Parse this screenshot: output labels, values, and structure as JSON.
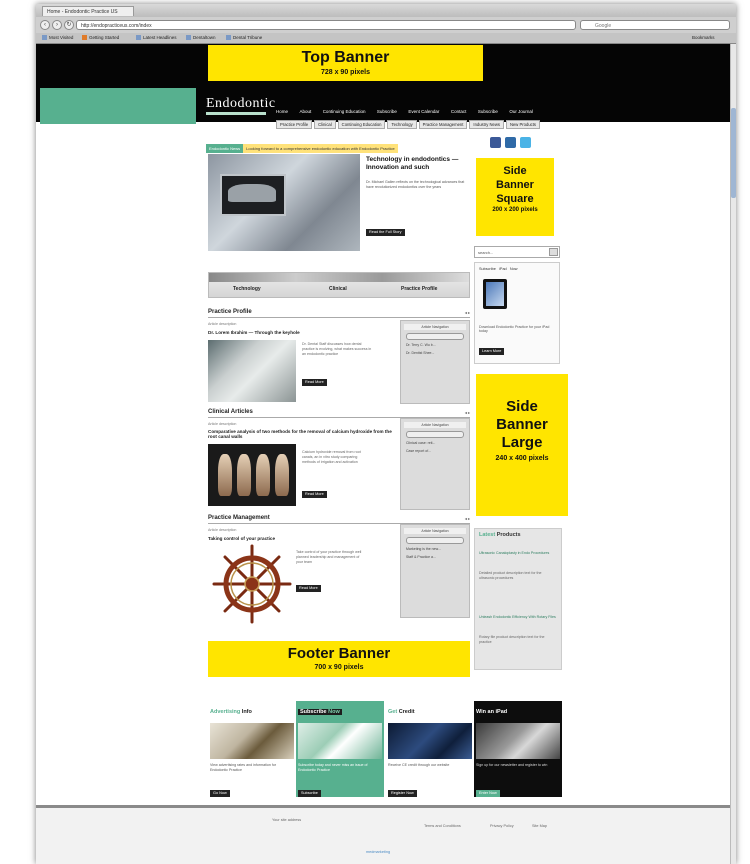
{
  "browser": {
    "tab_title": "Home - Endodontic Practice US",
    "url": "http://endopracticeus.com/index",
    "search_placeholder": "Google",
    "bookmarks": [
      "Most Visited",
      "Getting Started",
      "Latest Headlines",
      "Dentaltown",
      "Dental Tribune"
    ],
    "right_bookmark": "Bookmarks"
  },
  "banners": {
    "top": {
      "title": "Top Banner",
      "size": "728 x 90 pixels"
    },
    "side_square": {
      "line1": "Side",
      "line2": "Banner",
      "line3": "Square",
      "size": "200 x 200 pixels"
    },
    "side_large": {
      "line1": "Side",
      "line2": "Banner",
      "line3": "Large",
      "size": "240 x 400 pixels"
    },
    "footer": {
      "title": "Footer Banner",
      "size": "700 x 90 pixels"
    }
  },
  "site": {
    "logo": "Endodontic",
    "nav_primary": [
      "Home",
      "About",
      "Continuing Education",
      "Subscribe",
      "Event Calendar",
      "Contact",
      "Subscribe",
      "Our Journal"
    ],
    "nav_secondary": [
      "Practice Profile",
      "Clinical",
      "Continuing Education",
      "Technology",
      "Practice Management",
      "Industry News",
      "New Products"
    ],
    "ticker_label": "Endodontic News",
    "ticker_text": "Looking forward to a comprehensive endodontic education with Endodontic Practice"
  },
  "featured": {
    "title": "Technology in endodontics — Innovation and such",
    "desc": "Dr. Michael Gallen reflects on the technological advances that have revolutionized endodontics over the years",
    "button": "Read the Full Story"
  },
  "section_tabs": [
    "Technology",
    "Clinical",
    "Practice Profile"
  ],
  "practice_profile": {
    "heading": "Practice Profile",
    "sub": "Article description",
    "title": "Dr. Lorem Ibrahim — Through the keyhole",
    "desc": "Dr. Dental Staff discusses how dental practice is evolving, what makes success in an endodontic practice",
    "button": "Read More",
    "panel_head": "Article Navigation",
    "panel_items": [
      "Dr. Terry C. Wu b...",
      "Dr. Dentist Shee..."
    ]
  },
  "clinical": {
    "heading": "Clinical Articles",
    "sub": "Article description",
    "title": "Comparative analysis of two methods for the removal of calcium hydroxide from the root canal walls",
    "desc": "Calcium hydroxide removal from root canals, an in vitro study comparing methods of irrigation and activation",
    "button": "Read More",
    "panel_head": "Article Navigation",
    "panel_items": [
      "Clinical case: reti...",
      "Case report of..."
    ]
  },
  "practice_mgmt": {
    "heading": "Practice Management",
    "sub": "Article description",
    "title": "Taking control of your practice",
    "desc": "Take control of your practice through well planned leadership and management of your team",
    "button": "Read More",
    "panel_head": "Article Navigation",
    "panel_items": [
      "Marketing is the new...",
      "Staff & Practice a..."
    ]
  },
  "right_column": {
    "search_placeholder": "search...",
    "ipad_tabs": [
      "Subscribe",
      "iPad",
      "Now"
    ],
    "ipad_text": "Download Endodontic Practice for your iPad today",
    "ipad_button": "Learn More",
    "latest_head_1": "Latest",
    "latest_head_2": "Products",
    "latest_items": [
      {
        "link": "Ultrasonic Canaloplasty in Endo Procedures",
        "desc": "Detailed product description text for the ultrasonic procedures"
      },
      {
        "link": "Unleash Endodontic Efficiency With Rotary Files",
        "desc": "Rotary file product description text for the practice"
      }
    ]
  },
  "promos": [
    {
      "title_a": "Advertising",
      "title_b": " Info",
      "desc": "View advertising rates and information for Endodontic Practice",
      "button": "Go Now"
    },
    {
      "title_a": "Subscribe",
      "title_b": " Now",
      "desc": "Subscribe today and never miss an issue of Endodontic Practice",
      "button": "Subscribe"
    },
    {
      "title_a": "Get",
      "title_b": " Credit",
      "desc": "Receive CE credit through our website",
      "button": "Register Now"
    },
    {
      "title_a": "Win an iPad",
      "title_b": "",
      "desc": "Sign up for our newsletter and register to win",
      "button": "Enter Now"
    }
  ],
  "footer": {
    "copyright": "Your site address",
    "links": [
      "Terms and Conditions",
      "Privacy Policy",
      "Site Map"
    ],
    "credit": "medmarketing"
  },
  "colors": {
    "accent_green": "#57b08f",
    "banner_yellow": "#ffe500",
    "header_black": "#050505"
  }
}
